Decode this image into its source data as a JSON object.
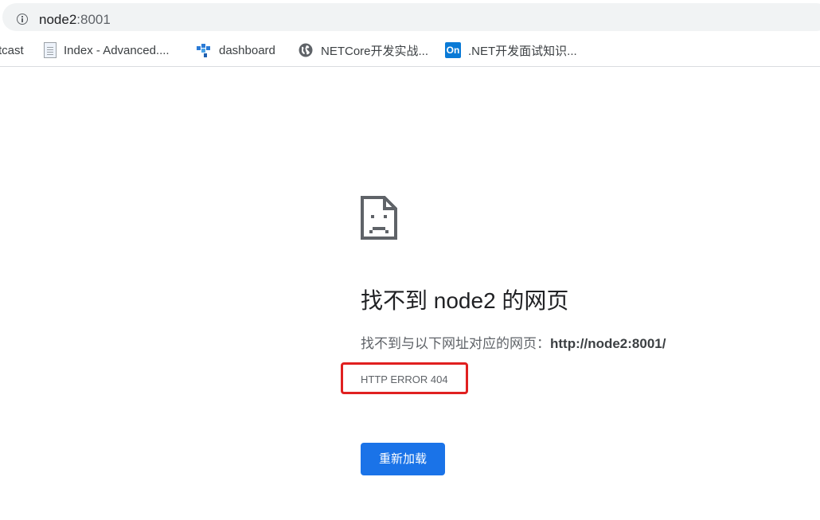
{
  "address_bar": {
    "host": "node2",
    "port": ":8001"
  },
  "bookmarks": [
    {
      "label": "tcast",
      "icon": "none"
    },
    {
      "label": "Index - Advanced....",
      "icon": "document-icon"
    },
    {
      "label": "dashboard",
      "icon": "dashboard-icon"
    },
    {
      "label": "NETCore开发实战...",
      "icon": "globe-icon"
    },
    {
      "label": ".NET开发面试知识...",
      "icon": "on-badge-icon",
      "icon_text": "On"
    }
  ],
  "error_page": {
    "title": "找不到 node2 的网页",
    "description_prefix": "找不到与以下网址对应的网页：",
    "description_url": "http://node2:8001/",
    "error_code": "HTTP ERROR 404",
    "reload_label": "重新加载"
  },
  "colors": {
    "accent": "#1a73e8",
    "highlight_box": "#e02020",
    "omnibox_bg": "#f1f3f4"
  }
}
